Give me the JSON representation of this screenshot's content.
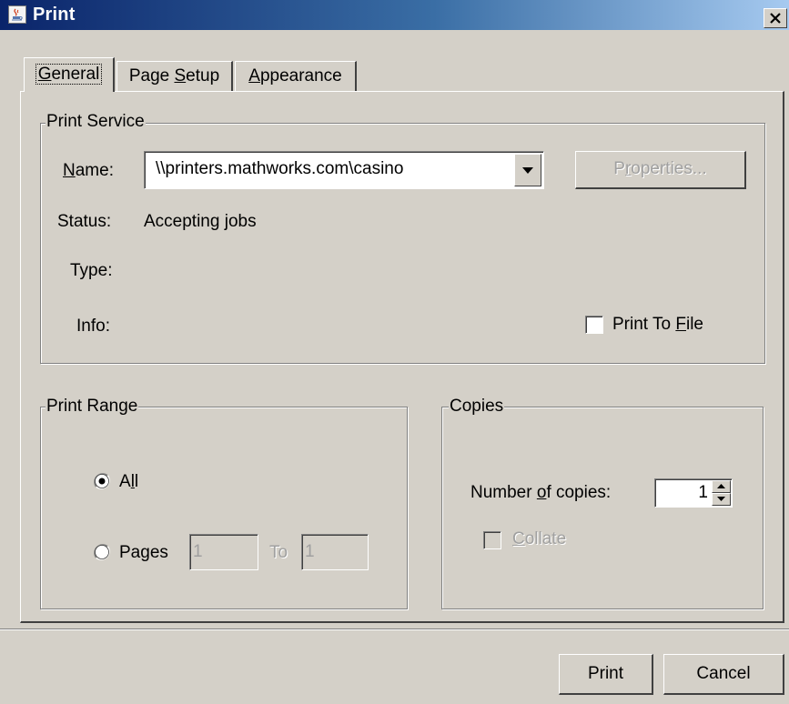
{
  "window": {
    "title": "Print",
    "icon": "java-cup-icon",
    "close_icon": "close-icon"
  },
  "tabs": [
    {
      "label": "General",
      "active": true
    },
    {
      "label": "Page Setup",
      "active": false
    },
    {
      "label": "Appearance",
      "active": false
    }
  ],
  "print_service": {
    "title": "Print Service",
    "name_label": "Name:",
    "name_value": "\\\\printers.mathworks.com\\casino",
    "properties_label": "Properties...",
    "status_label": "Status:",
    "status_value": "Accepting jobs",
    "type_label": "Type:",
    "info_label": "Info:",
    "print_to_file_label": "Print To File",
    "print_to_file_checked": false
  },
  "print_range": {
    "title": "Print Range",
    "all_label": "All",
    "all_selected": true,
    "pages_label": "Pages",
    "from_value": "1",
    "to_label": "To",
    "to_value": "1"
  },
  "copies": {
    "title": "Copies",
    "number_label": "Number of copies:",
    "number_value": "1",
    "collate_label": "Collate",
    "collate_checked": false
  },
  "buttons": {
    "print": "Print",
    "cancel": "Cancel"
  },
  "colors": {
    "dialog_bg": "#d4d0c8",
    "title_start": "#0a246a",
    "title_end": "#a6caf0",
    "disabled_text": "#a0a0a0"
  }
}
